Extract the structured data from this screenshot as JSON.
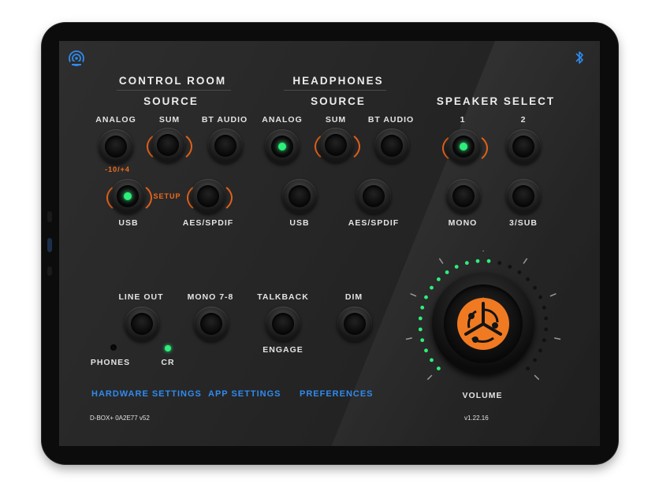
{
  "control_room": {
    "title": "CONTROL ROOM",
    "source_title": "SOURCE",
    "labels": {
      "analog": "ANALOG",
      "sum": "SUM",
      "bt_audio": "BT AUDIO",
      "trim": "-10/+4",
      "usb": "USB",
      "setup": "SETUP",
      "aes": "AES/SPDIF"
    }
  },
  "headphones": {
    "title": "HEADPHONES",
    "source_title": "SOURCE",
    "labels": {
      "analog": "ANALOG",
      "sum": "SUM",
      "bt_audio": "BT AUDIO",
      "usb": "USB",
      "aes": "AES/SPDIF"
    }
  },
  "speaker_select": {
    "title": "SPEAKER SELECT",
    "labels": {
      "s1": "1",
      "s2": "2",
      "mono": "MONO",
      "sub": "3/SUB"
    }
  },
  "outputs": {
    "line_out": "LINE OUT",
    "mono78": "MONO 7-8",
    "talkback": "TALKBACK",
    "engage": "ENGAGE",
    "dim": "DIM",
    "phones": "PHONES",
    "cr": "CR"
  },
  "volume": {
    "label": "VOLUME",
    "level": 0.55
  },
  "links": {
    "hardware": "HARDWARE SETTINGS",
    "app": "APP SETTINGS",
    "prefs": "PREFERENCES"
  },
  "footer": {
    "device": "D-BOX+ 0A2E77 v52",
    "version": "v1.22.16"
  },
  "icons": {
    "top_left": "broadcast-icon",
    "top_right": "bluetooth-icon",
    "volume_center": "music-note-logo-icon"
  },
  "colors": {
    "accent_orange": "#f26b1d",
    "led_green": "#2cf07a",
    "link_blue": "#2f8bf0"
  }
}
